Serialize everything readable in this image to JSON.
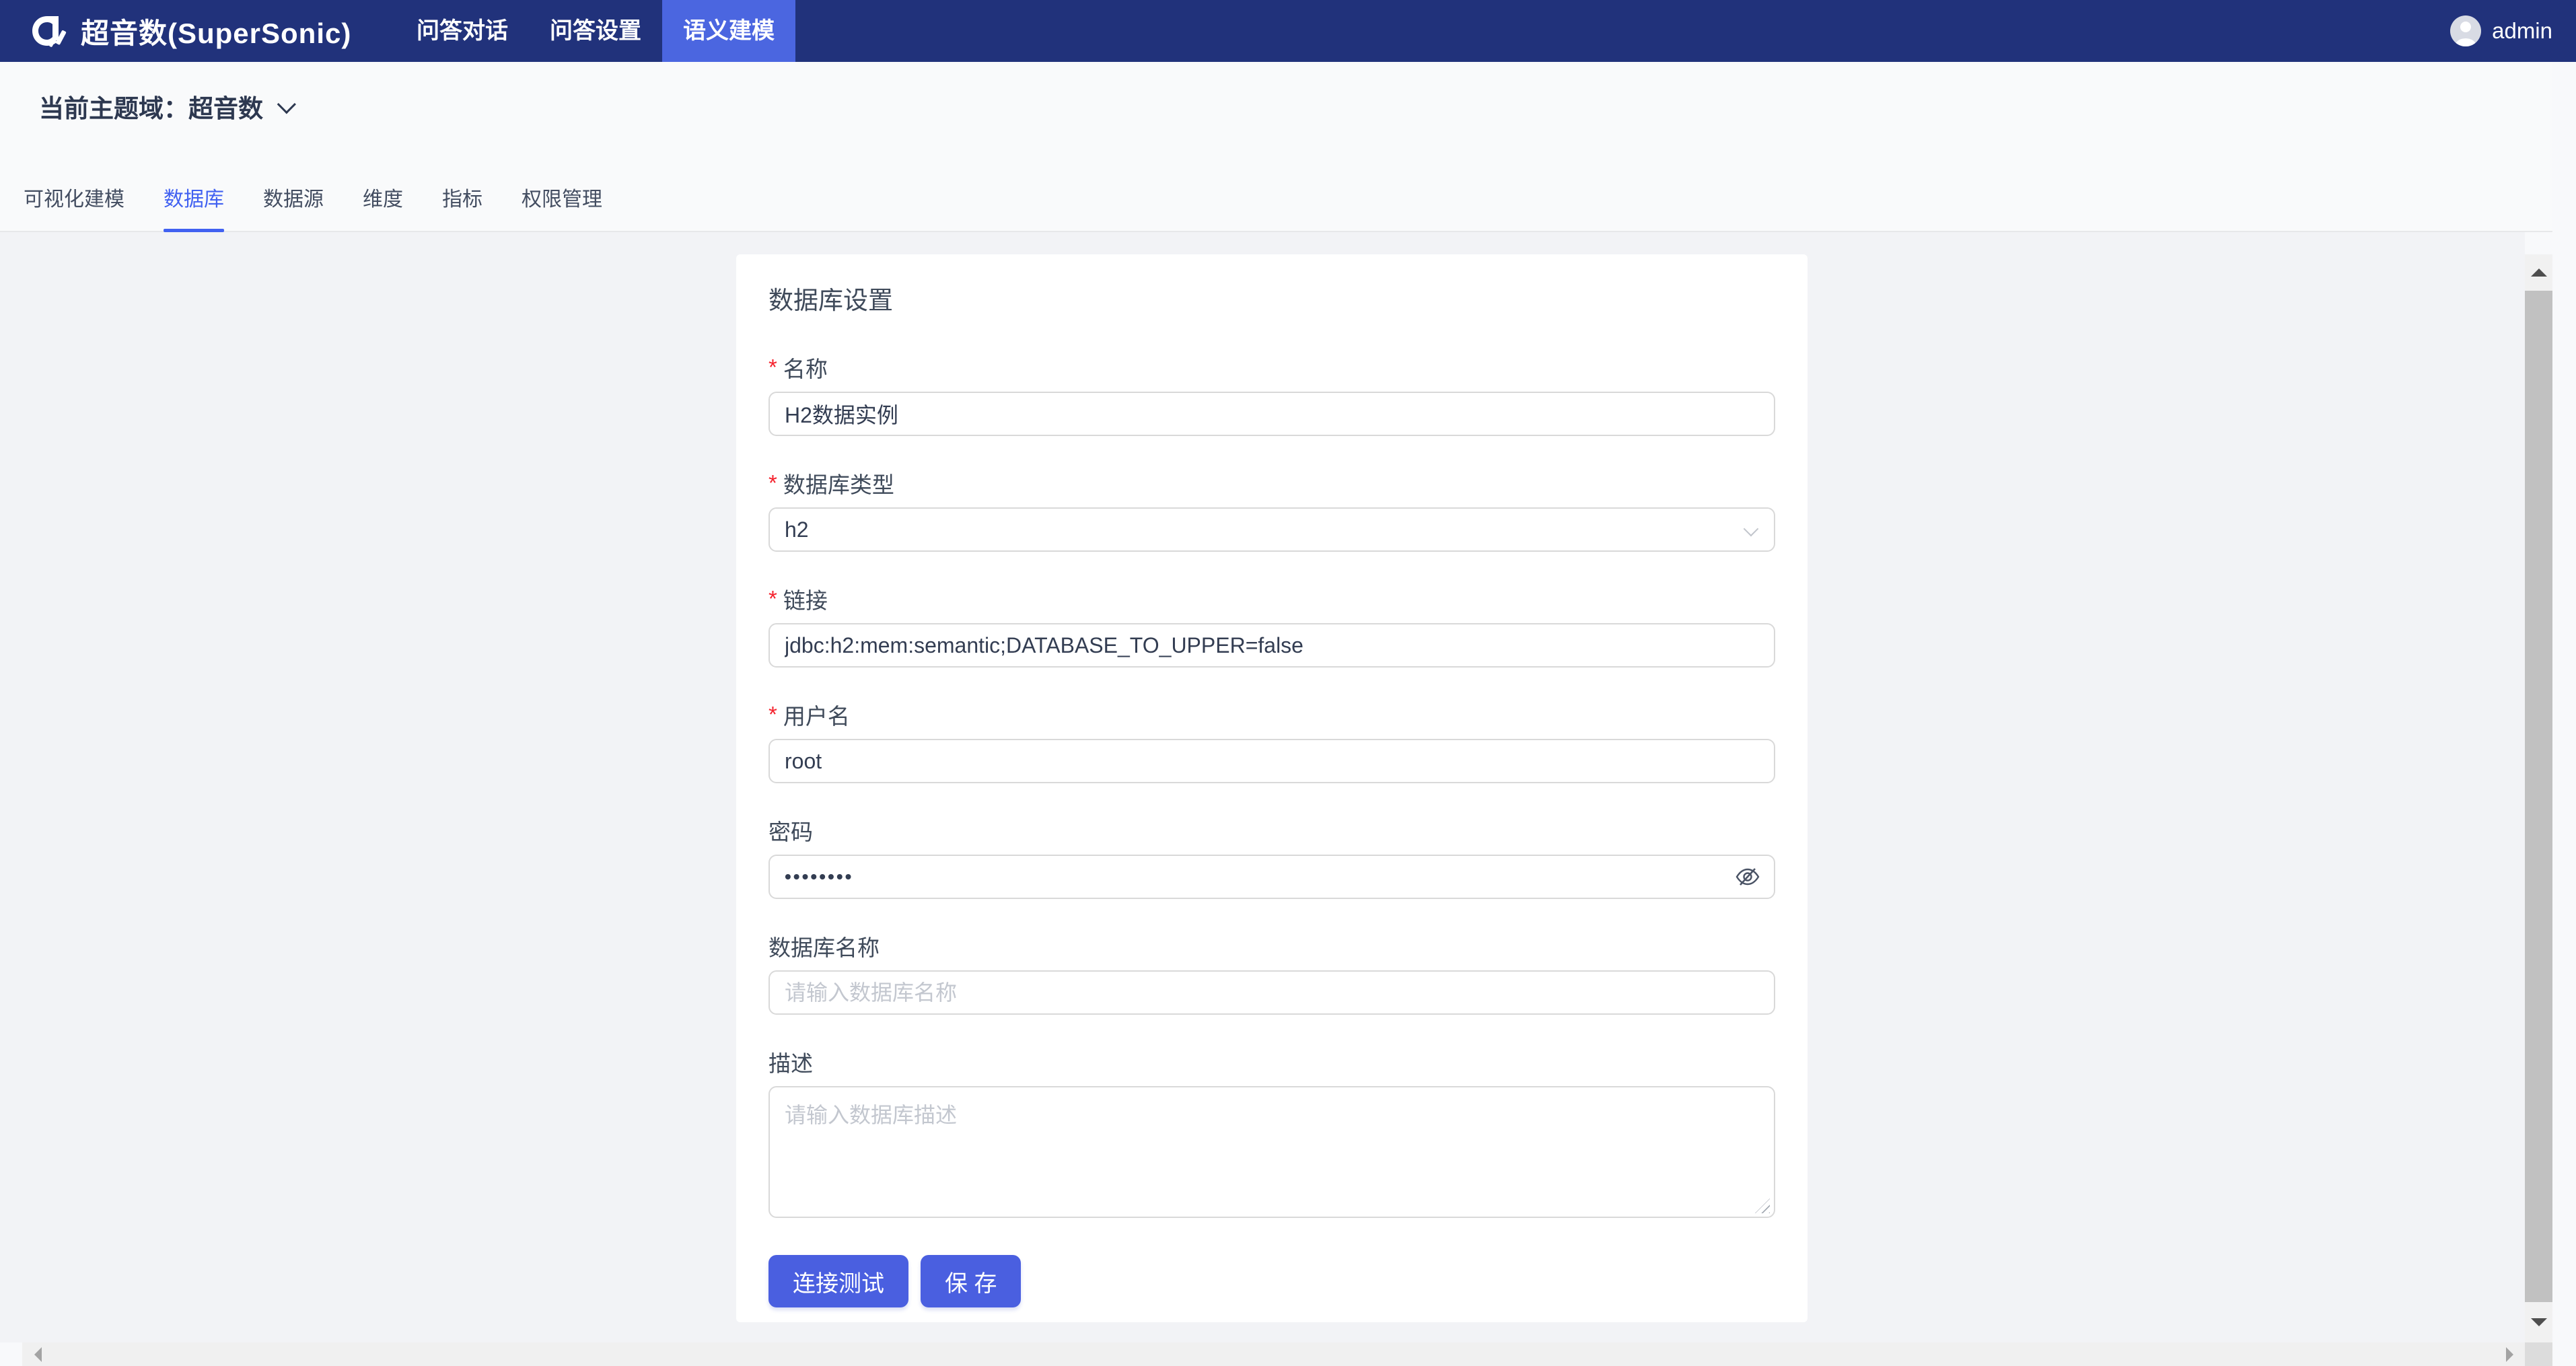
{
  "navbar": {
    "brand": "超音数(SuperSonic)",
    "items": [
      {
        "label": "问答对话",
        "active": false
      },
      {
        "label": "问答设置",
        "active": false
      },
      {
        "label": "语义建模",
        "active": true
      }
    ],
    "user": "admin"
  },
  "domain_bar": {
    "label": "当前主题域：",
    "value": "超音数"
  },
  "tabs": [
    {
      "label": "可视化建模",
      "active": false
    },
    {
      "label": "数据库",
      "active": true
    },
    {
      "label": "数据源",
      "active": false
    },
    {
      "label": "维度",
      "active": false
    },
    {
      "label": "指标",
      "active": false
    },
    {
      "label": "权限管理",
      "active": false
    }
  ],
  "form": {
    "title": "数据库设置",
    "required_marker": "*",
    "fields": [
      {
        "label": "名称",
        "required": true,
        "type": "text",
        "value": "H2数据实例"
      },
      {
        "label": "数据库类型",
        "required": true,
        "type": "select",
        "value": "h2"
      },
      {
        "label": "链接",
        "required": true,
        "type": "text",
        "value": "jdbc:h2:mem:semantic;DATABASE_TO_UPPER=false"
      },
      {
        "label": "用户名",
        "required": true,
        "type": "text",
        "value": "root"
      },
      {
        "label": "密码",
        "required": false,
        "type": "password",
        "value": "••••••••"
      },
      {
        "label": "数据库名称",
        "required": false,
        "type": "text",
        "value": "",
        "placeholder": "请输入数据库名称"
      },
      {
        "label": "描述",
        "required": false,
        "type": "textarea",
        "value": "",
        "placeholder": "请输入数据库描述"
      }
    ],
    "buttons": [
      {
        "label": "连接测试"
      },
      {
        "label": "保 存"
      }
    ]
  },
  "icons": {
    "logo": "supersonic-note-logo",
    "password_toggle": "eye-invisible-icon",
    "domain_dropdown": "chevron-down-icon",
    "select_dropdown": "chevron-down-icon"
  },
  "colors": {
    "navbar_bg": "#21327b",
    "navbar_active_bg": "#4b66e0",
    "tab_active": "#4161f1",
    "button_bg": "#4a5fe0",
    "required_star": "#f5222d",
    "content_bg": "#f2f3f6",
    "card_bg": "#ffffff",
    "input_border": "#d9d9d9",
    "scroll_thumb": "#c1c1c1"
  }
}
